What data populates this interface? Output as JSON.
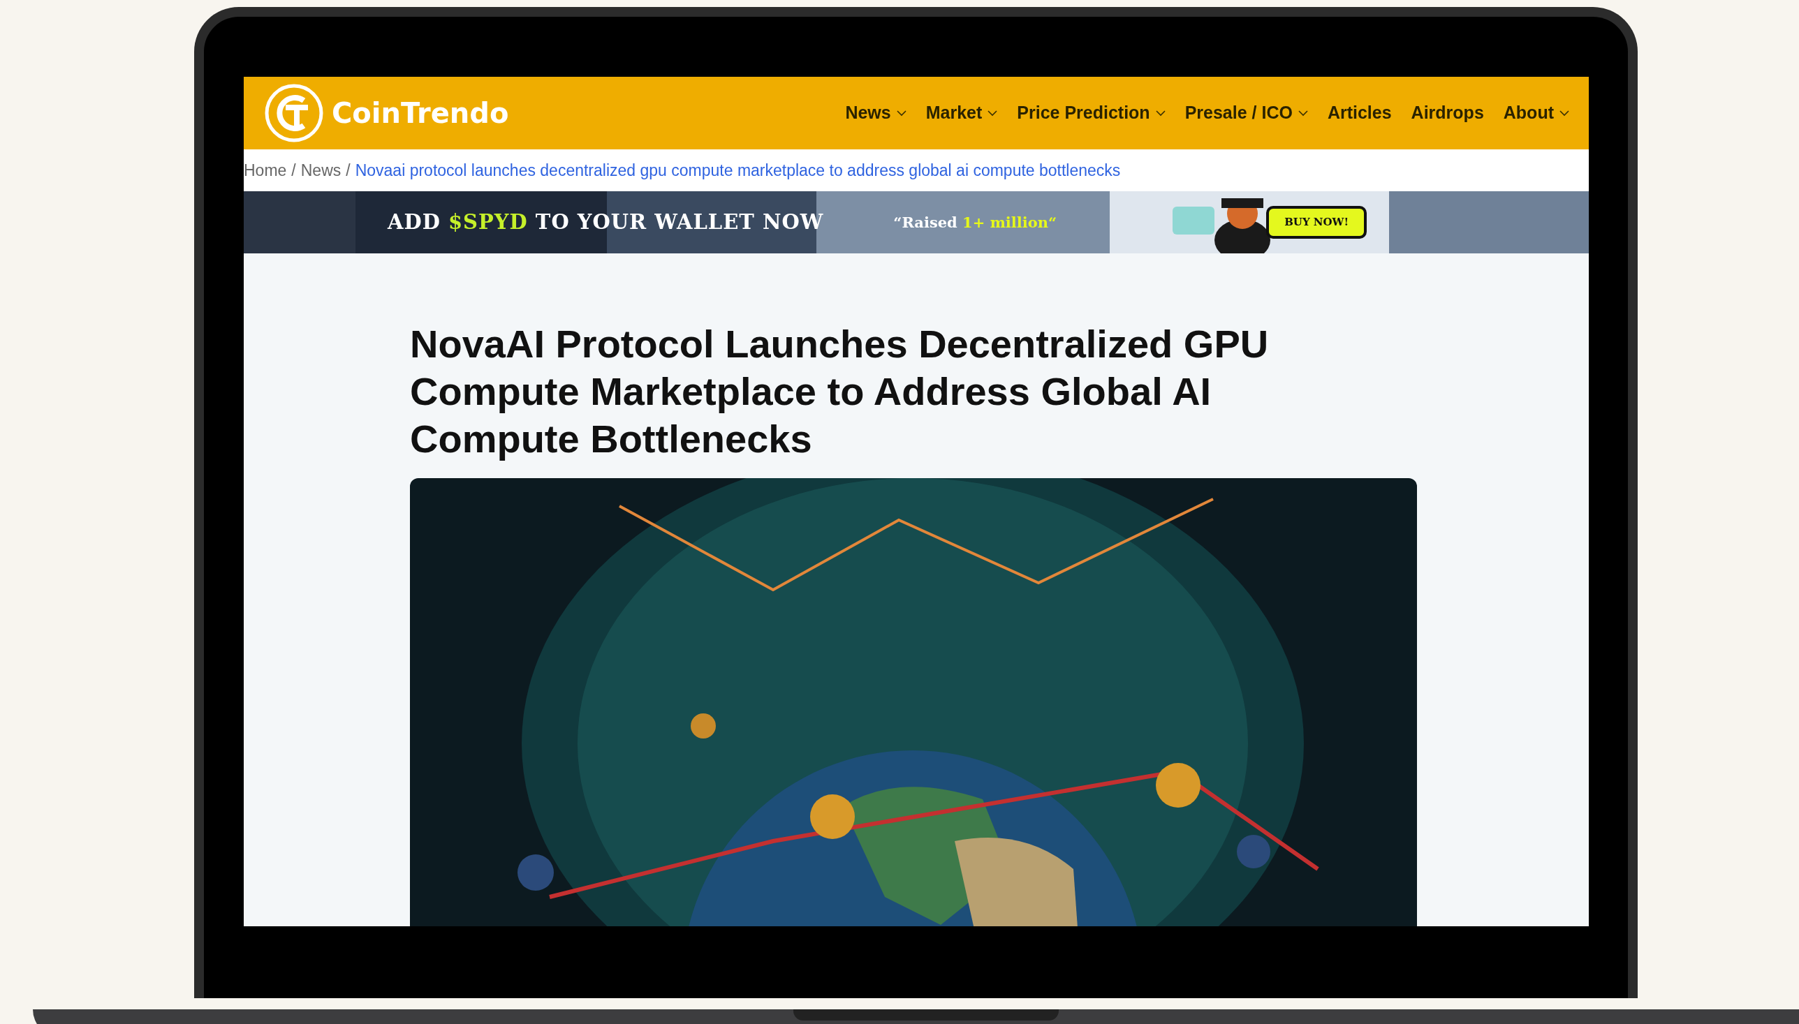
{
  "header": {
    "logo_text": "CoinTrendo"
  },
  "nav": [
    {
      "label": "News",
      "dropdown": true
    },
    {
      "label": "Market",
      "dropdown": true
    },
    {
      "label": "Price Prediction",
      "dropdown": true
    },
    {
      "label": "Presale / ICO",
      "dropdown": true
    },
    {
      "label": "Articles",
      "dropdown": false
    },
    {
      "label": "Airdrops",
      "dropdown": false
    },
    {
      "label": "About",
      "dropdown": true
    }
  ],
  "breadcrumb": {
    "separator": "/",
    "items": [
      {
        "label": "Home",
        "current": false
      },
      {
        "label": "News",
        "current": false
      },
      {
        "label": "Novaai protocol launches decentralized gpu compute marketplace to address global ai compute bottlenecks",
        "current": true
      }
    ]
  },
  "banner": {
    "headline": [
      {
        "text": "ADD",
        "highlight": false
      },
      {
        "text": "$SPYD",
        "highlight": true
      },
      {
        "text": "TO YOUR WALLET NOW",
        "highlight": false
      }
    ],
    "raised": [
      {
        "text": "“Raised",
        "highlight": false
      },
      {
        "text": "1+ million“",
        "highlight": true
      }
    ],
    "button": "BUY NOW!"
  },
  "article": {
    "title": "NovaAI Protocol Launches Decentralized GPU Compute Marketplace to Address Global AI Compute Bottlenecks"
  }
}
